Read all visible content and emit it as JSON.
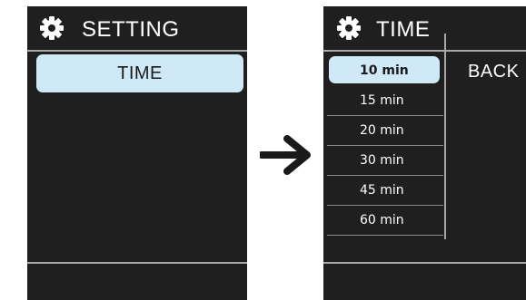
{
  "left_screen": {
    "title": "SETTING",
    "title_icon": "gear-icon",
    "items": [
      {
        "label": "TIME",
        "selected": true
      }
    ]
  },
  "transition_icon": "right-arrow-icon",
  "right_screen": {
    "title": "TIME",
    "title_icon": "gear-icon",
    "options": [
      {
        "label": "10 min",
        "selected": true
      },
      {
        "label": "15 min",
        "selected": false
      },
      {
        "label": "20 min",
        "selected": false
      },
      {
        "label": "30 min",
        "selected": false
      },
      {
        "label": "45 min",
        "selected": false
      },
      {
        "label": "60 min",
        "selected": false
      }
    ],
    "back_label": "BACK"
  },
  "colors": {
    "screen_bg": "#1f1f1f",
    "highlight": "#cfe9f7",
    "divider": "#a8a8a8",
    "text": "#ffffff"
  }
}
